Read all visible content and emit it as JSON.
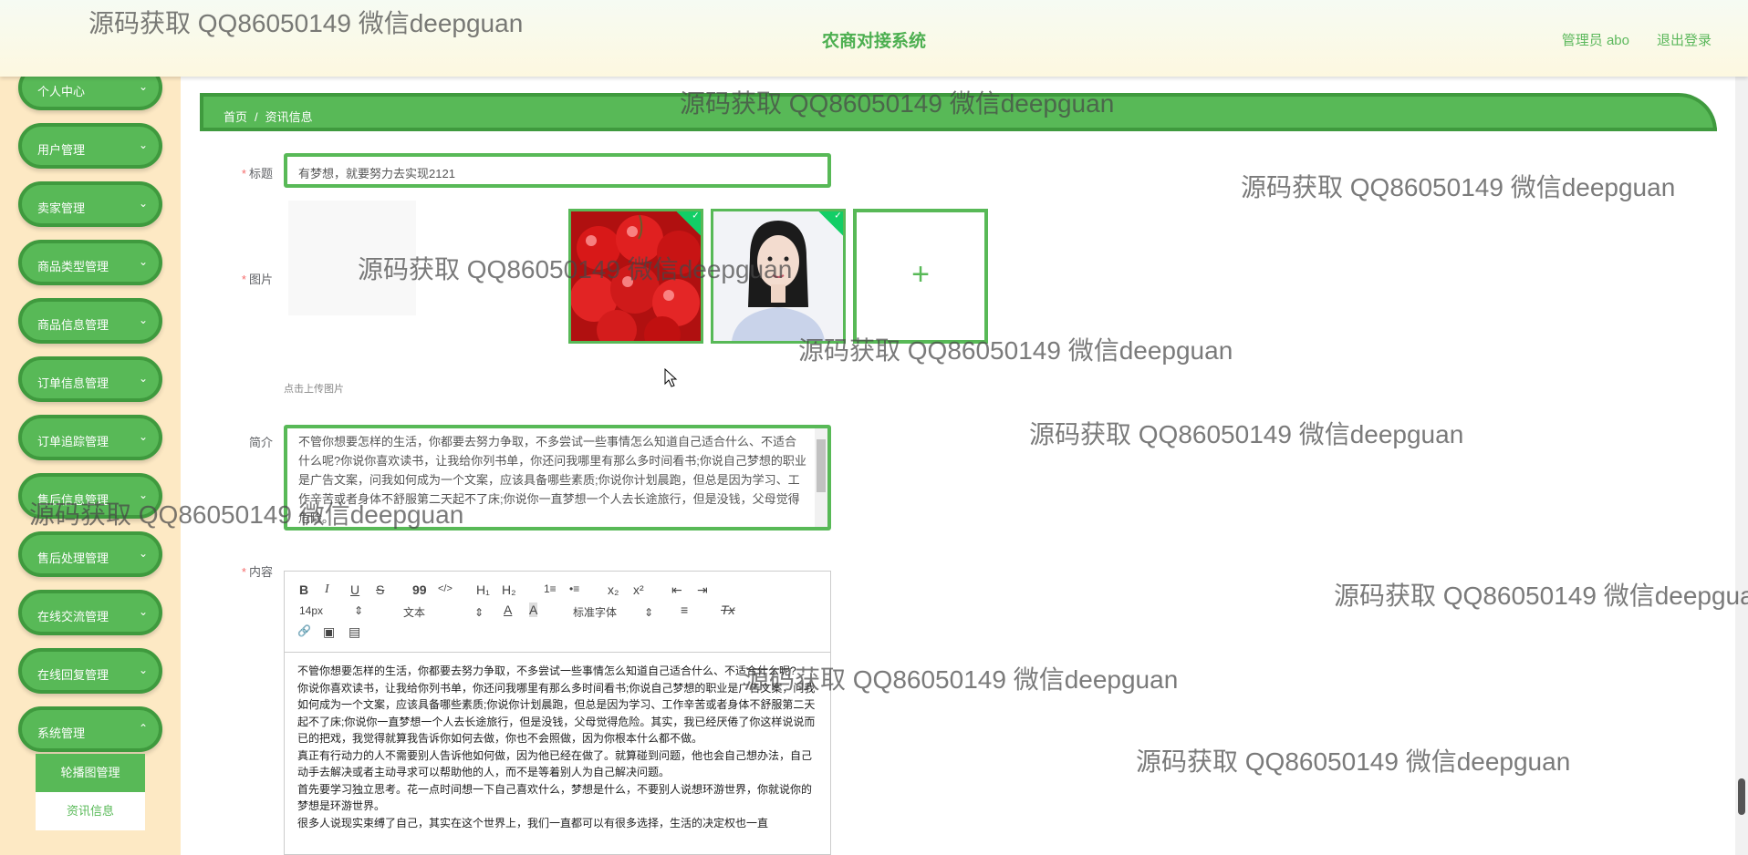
{
  "header": {
    "title": "农商对接系统",
    "user": "管理员 abo",
    "logout": "退出登录"
  },
  "sidebar": {
    "items": [
      {
        "label": "个人中心"
      },
      {
        "label": "用户管理"
      },
      {
        "label": "卖家管理"
      },
      {
        "label": "商品类型管理"
      },
      {
        "label": "商品信息管理"
      },
      {
        "label": "订单信息管理"
      },
      {
        "label": "订单追踪管理"
      },
      {
        "label": "售后信息管理"
      },
      {
        "label": "售后处理管理"
      },
      {
        "label": "在线交流管理"
      },
      {
        "label": "在线回复管理"
      },
      {
        "label": "系统管理"
      }
    ],
    "submenu": [
      {
        "label": "轮播图管理"
      },
      {
        "label": "资讯信息"
      }
    ]
  },
  "breadcrumb": {
    "home": "首页",
    "separator": "/",
    "current": "资讯信息"
  },
  "form": {
    "title_label": "标题",
    "title_value": "有梦想，就要努力去实现2121",
    "image_label": "图片",
    "upload_tip": "点击上传图片",
    "intro_label": "简介",
    "intro_text": "不管你想要怎样的生活，你都要去努力争取，不多尝试一些事情怎么知道自己适合什么、不适合什么呢?你说你喜欢读书，让我给你列书单，你还问我哪里有那么多时间看书;你说自己梦想的职业是广告文案，问我如何成为一个文案，应该具备哪些素质;你说你计划晨跑，但总是因为学习、工作辛苦或者身体不舒服第二天起不了床;你说你一直梦想一个人去长途旅行，但是没钱，父母觉得危险。",
    "content_label": "内容",
    "required_mark": "*"
  },
  "editor": {
    "toolbar": {
      "bold": "B",
      "italic": "I",
      "underline": "U",
      "strike": "S",
      "quote": "99",
      "code": "</>",
      "h1": "H₁",
      "h2": "H₂",
      "ordered": "1≡",
      "bullet": "•≡",
      "sub": "x₂",
      "sup": "x²",
      "outdent": "⇤",
      "indent": "⇥",
      "size": "14px",
      "format": "文本",
      "font": "标准字体",
      "color": "A",
      "bg": "A",
      "align": "≡",
      "clear": "Tx",
      "link": "🔗",
      "image": "▣",
      "video": "▤"
    },
    "content": [
      "不管你想要怎样的生活，你都要去努力争取，不多尝试一些事情怎么知道自己适合什么、不适合什么呢?",
      "你说你喜欢读书，让我给你列书单，你还问我哪里有那么多时间看书;你说自己梦想的职业是广告文案，问我如何成为一个文案，应该具备哪些素质;你说你计划晨跑，但总是因为学习、工作辛苦或者身体不舒服第二天起不了床;你说你一直梦想一个人去长途旅行，但是没钱，父母觉得危险。其实，我已经厌倦了你这样说说而已的把戏，我觉得就算我告诉你如何去做，你也不会照做，因为你根本什么都不做。",
      "真正有行动力的人不需要别人告诉他如何做，因为他已经在做了。就算碰到问题，他也会自己想办法，自己动手去解决或者主动寻求可以帮助他的人，而不是等着别人为自己解决问题。",
      "首先要学习独立思考。花一点时间想一下自己喜欢什么，梦想是什么，不要别人说想环游世界，你就说你的梦想是环游世界。",
      "很多人说现实束缚了自己，其实在这个世界上，我们一直都可以有很多选择，生活的决定权也一直"
    ]
  },
  "watermark": "源码获取 QQ86050149 微信deepguan"
}
